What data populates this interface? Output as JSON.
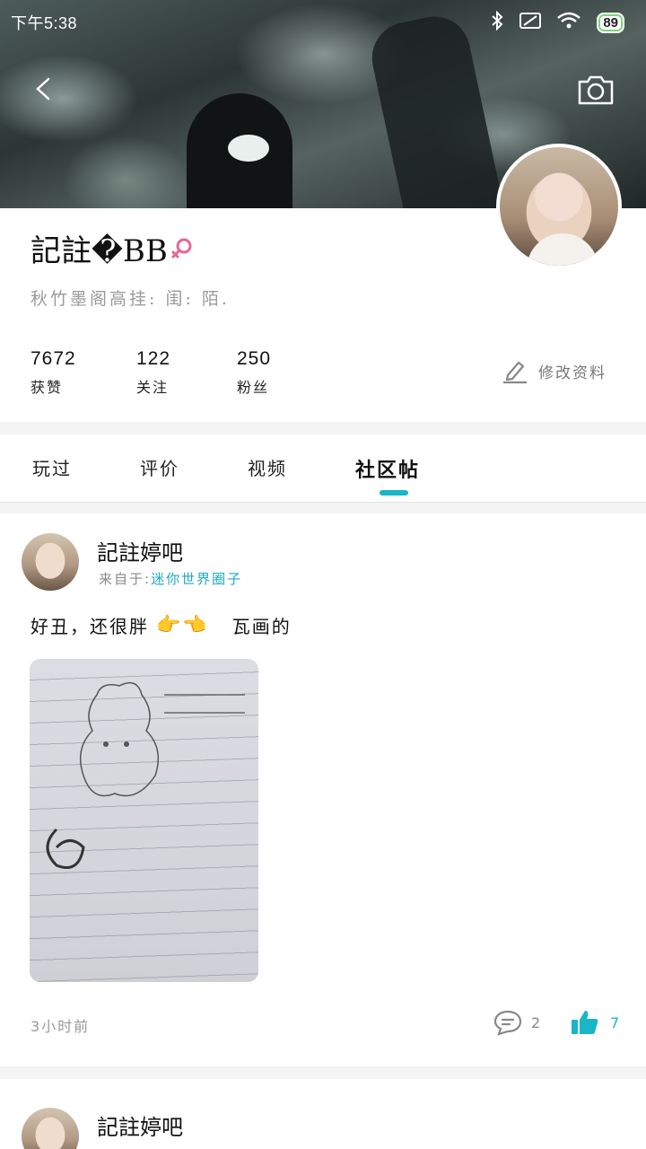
{
  "status_bar": {
    "time": "下午5:38",
    "battery": "89"
  },
  "profile": {
    "name": "記註�BB",
    "signature": "秋竹墨阁高挂: 闺: 陌.",
    "stats": [
      {
        "value": "7672",
        "label": "获赞"
      },
      {
        "value": "122",
        "label": "关注"
      },
      {
        "value": "250",
        "label": "粉丝"
      }
    ],
    "edit_label": "修改资料"
  },
  "tabs": [
    {
      "label": "玩过",
      "active": false
    },
    {
      "label": "评价",
      "active": false
    },
    {
      "label": "视频",
      "active": false
    },
    {
      "label": "社区帖",
      "active": true
    }
  ],
  "posts": [
    {
      "author": "記註婷吧",
      "source_prefix": "来自于:",
      "source_name": "迷你世界圈子",
      "text_before": "好丑，还很胖",
      "text_after": "瓦画的",
      "time": "3小时前",
      "comments": "2",
      "likes": "7"
    },
    {
      "author": "記註婷吧"
    }
  ],
  "colors": {
    "accent": "#1ab5c6",
    "gender": "#e8658f"
  }
}
